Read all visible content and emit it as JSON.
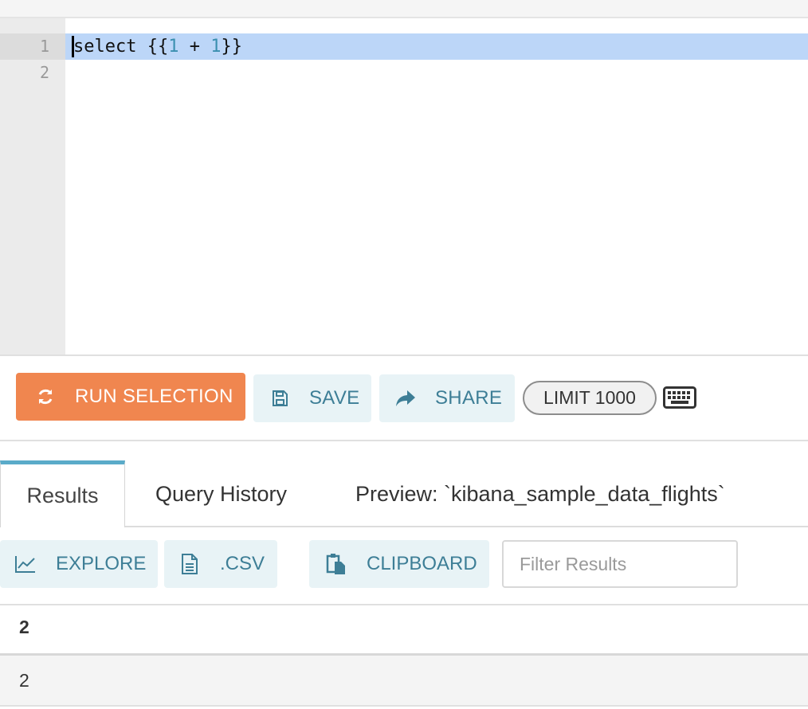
{
  "editor": {
    "line_numbers": [
      "1",
      "2"
    ],
    "code": {
      "kw": "select",
      "open": " {{",
      "n1": "1",
      "op": " + ",
      "n2": "1",
      "close": "}}"
    }
  },
  "toolbar": {
    "run_label": "RUN SELECTION",
    "save_label": "SAVE",
    "share_label": "SHARE",
    "limit_label": "LIMIT 1000"
  },
  "tabs": [
    {
      "label": "Results"
    },
    {
      "label": "Query History"
    },
    {
      "label": "Preview: `kibana_sample_data_flights`"
    }
  ],
  "results_actions": {
    "explore_label": "EXPLORE",
    "csv_label": ".CSV",
    "clipboard_label": "CLIPBOARD",
    "filter_placeholder": "Filter Results"
  },
  "table": {
    "columns": [
      "2"
    ],
    "rows": [
      [
        "2"
      ]
    ]
  },
  "colors": {
    "run_button": "#f0864f",
    "accent": "#3d7e96",
    "active_line": "#bcd6f8"
  }
}
